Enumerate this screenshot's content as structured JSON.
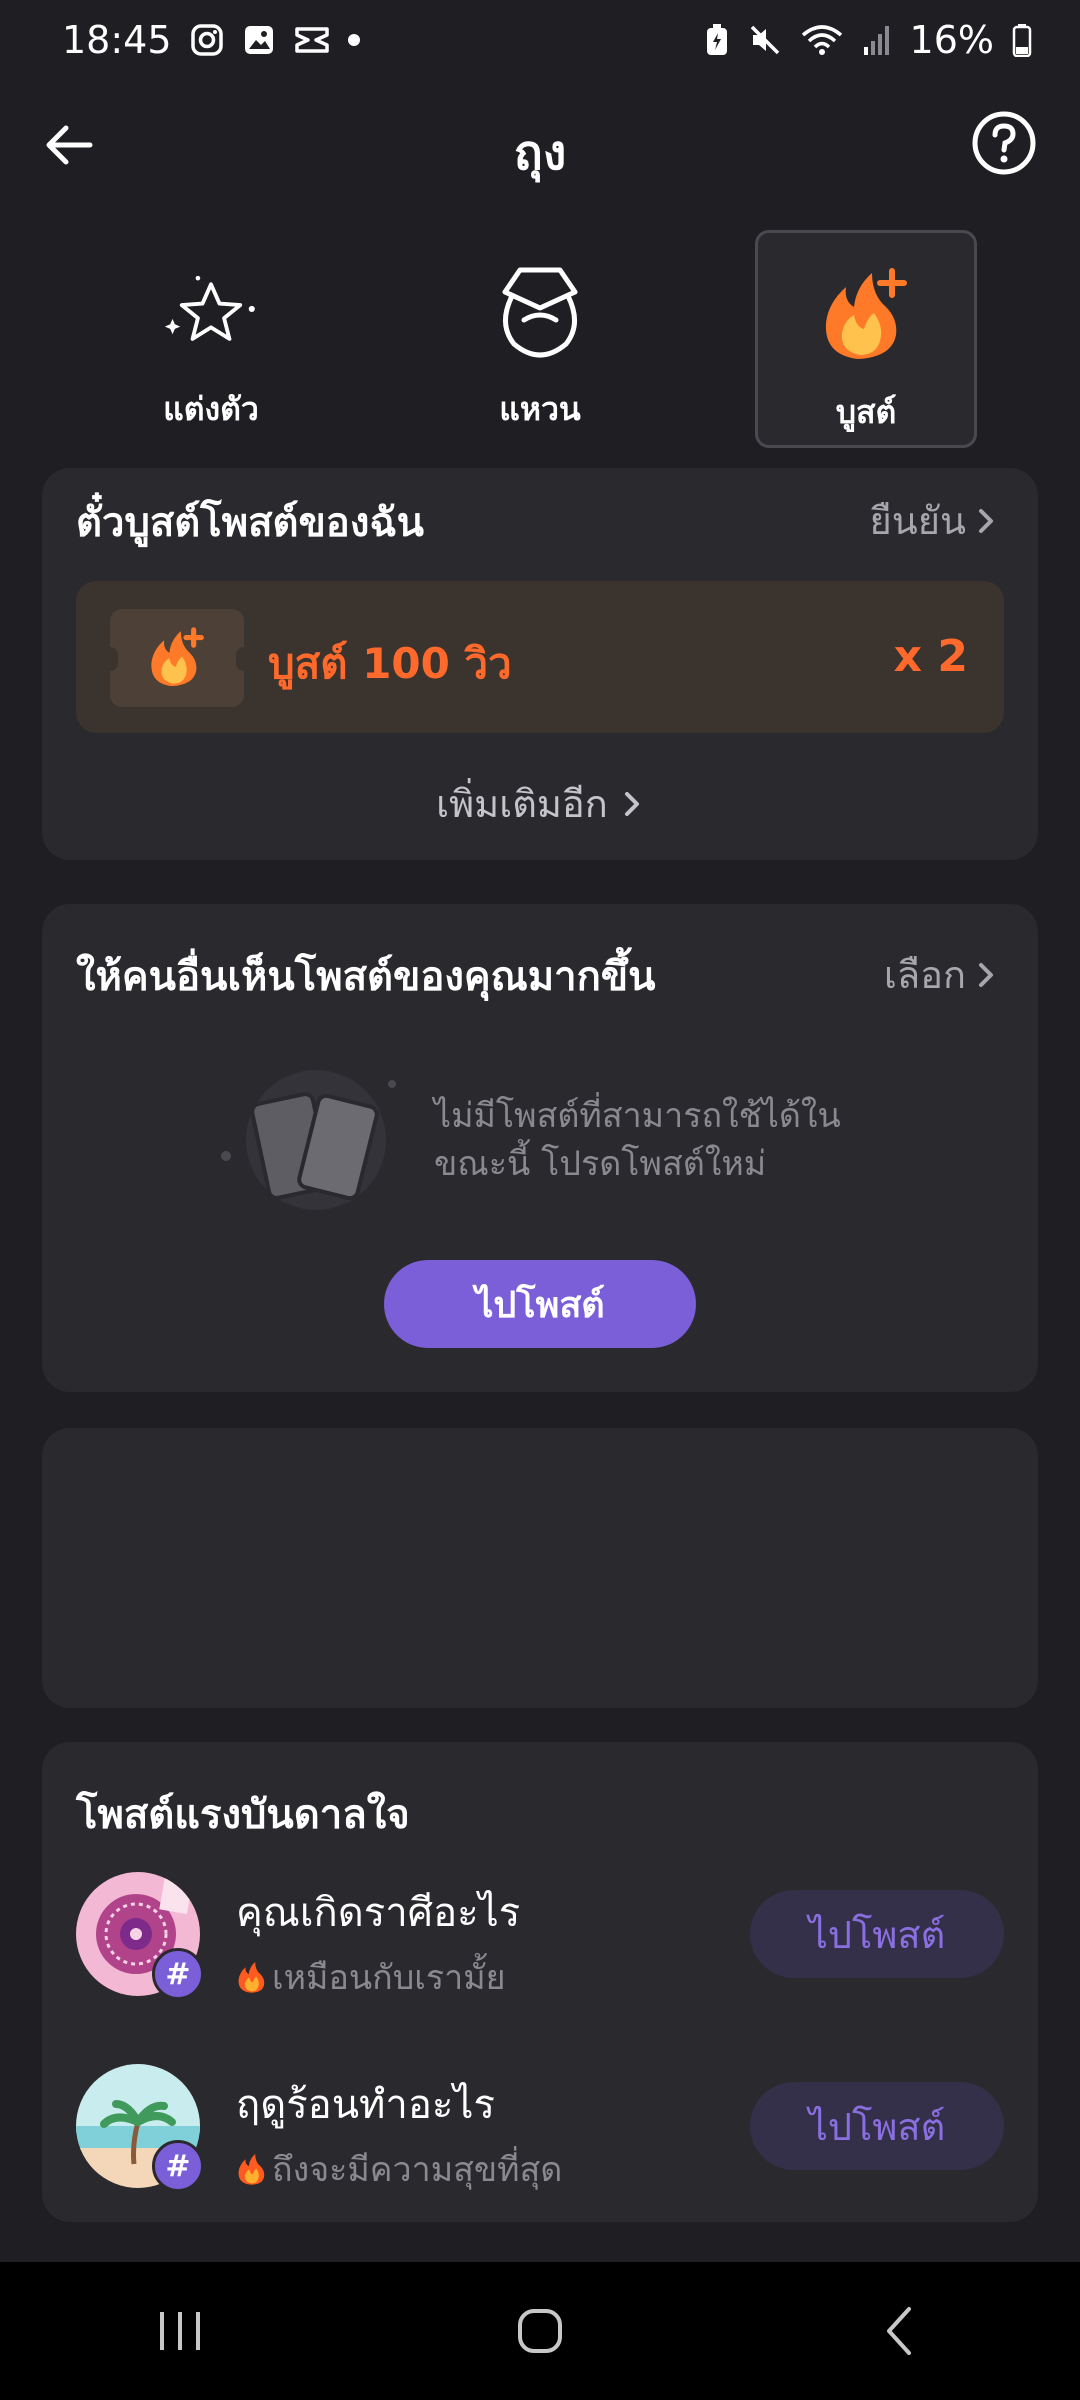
{
  "status_bar": {
    "time": "18:45",
    "battery": "16%",
    "left_icons": [
      "instagram-icon",
      "gallery-icon",
      "capcut-icon",
      "dot-icon"
    ],
    "right_icons": [
      "battery-saver-icon",
      "mute-icon",
      "wifi-icon",
      "signal-icon",
      "battery-icon"
    ]
  },
  "header": {
    "title": "ถุง",
    "back_icon": "arrow-left-icon",
    "help_icon": "question-circle-icon"
  },
  "tabs": [
    {
      "label": "แต่งตัว",
      "icon": "sparkle-star-icon",
      "active": false
    },
    {
      "label": "แหวน",
      "icon": "ring-icon",
      "active": false
    },
    {
      "label": "บูสต์",
      "icon": "flame-plus-icon",
      "active": true
    }
  ],
  "boost_card": {
    "title": "ตั๋วบูสต์โพสต์ของฉัน",
    "action": "ยืนยัน",
    "item": {
      "label": "บูสต์ 100 วิว",
      "quantity": "x 2"
    },
    "more_link": "เพิ่มเติมอีก"
  },
  "visibility_card": {
    "title": "ให้คนอื่นเห็นโพสต์ของคุณมากขึ้น",
    "action": "เลือก",
    "empty_line1": "ไม่มีโพสต์ที่สามารถใช้ได้ใน",
    "empty_line2": "ขณะนี้ โปรดโพสต์ใหม่",
    "button": "ไปโพสต์"
  },
  "inspiration_card": {
    "title": "โพสต์แรงบันดาลใจ",
    "items": [
      {
        "title": "คุณเกิดราศีอะไร",
        "subtitle": "เหมือนกับเรามั้ย",
        "button": "ไปโพสต์",
        "hash": "#"
      },
      {
        "title": "ฤดูร้อนทำอะไร",
        "subtitle": "ถึงจะมีความสุขที่สุด",
        "button": "ไปโพสต์",
        "hash": "#"
      }
    ]
  },
  "colors": {
    "background": "#1f1e23",
    "card": "#2a292e",
    "accent_purple": "#7b5fd9",
    "boost_orange": "#ff6a2c"
  }
}
